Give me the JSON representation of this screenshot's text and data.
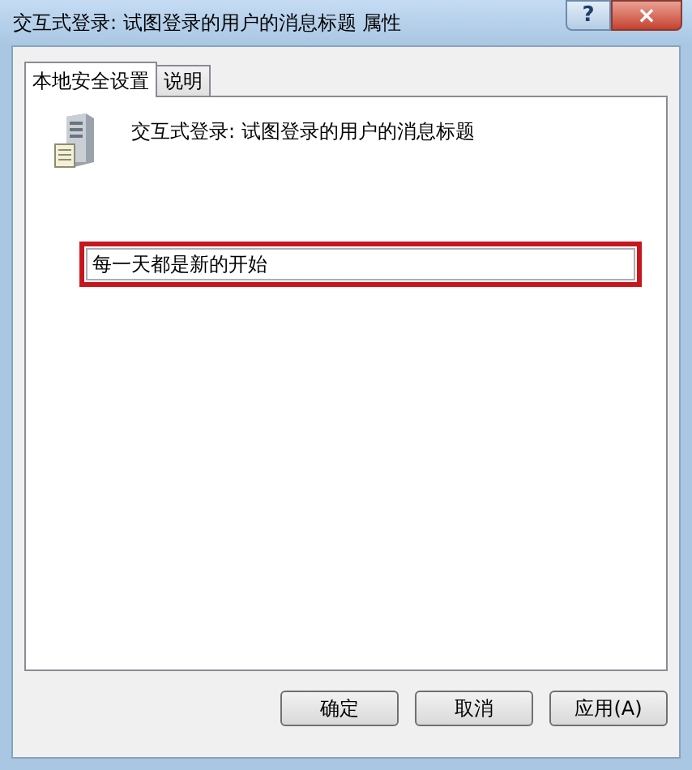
{
  "window": {
    "title": "交互式登录: 试图登录的用户的消息标题 属性",
    "help_button": "?",
    "close_button": "×"
  },
  "tabs": [
    {
      "label": "本地安全设置",
      "selected": true
    },
    {
      "label": "说明",
      "selected": false
    }
  ],
  "policy": {
    "name": "交互式登录: 试图登录的用户的消息标题"
  },
  "field": {
    "value": "每一天都是新的开始",
    "highlighted": true
  },
  "buttons": [
    "确定",
    "取消",
    "应用(A)"
  ]
}
